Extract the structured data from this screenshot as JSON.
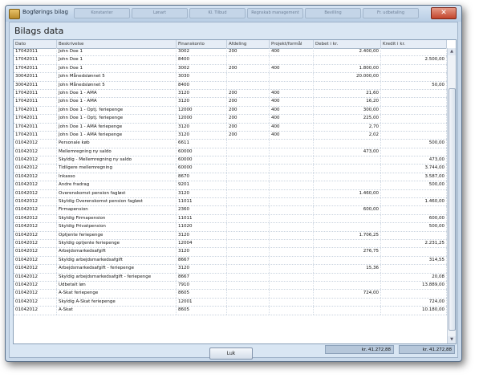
{
  "window": {
    "title": "Bogførings bilag",
    "background_tabs": [
      "Konstanter",
      "Lønart",
      "Kl. Tilbud",
      "Regnskab management",
      "Bevilling",
      "Fr. udbetaling"
    ],
    "close_glyph": "✕"
  },
  "heading": "Bilags data",
  "table": {
    "columns": [
      "Dato",
      "Beskrivelse",
      "Finanskonto",
      "Afdeling",
      "Projekt/formål",
      "Debet i kr.",
      "Kredit i kr."
    ],
    "rows": [
      [
        "17042011",
        "John Doe 1",
        "3002",
        "200",
        "400",
        "2.400,00",
        ""
      ],
      [
        "17042011",
        "John Doe 1",
        "8400",
        "",
        "",
        "",
        "2.500,00"
      ],
      [
        "17042011",
        "John Doe 1",
        "3002",
        "200",
        "400",
        "1.800,00",
        ""
      ],
      [
        "30042011",
        "John  Månedslønnet  5",
        "3030",
        "",
        "",
        "20.000,00",
        ""
      ],
      [
        "30042011",
        "John  Månedslønnet  5",
        "8400",
        "",
        "",
        "",
        "50,00"
      ],
      [
        "17042011",
        "John Doe 1 - AMA",
        "3120",
        "200",
        "400",
        "21,60",
        ""
      ],
      [
        "17042011",
        "John Doe 1 - AMA",
        "3120",
        "200",
        "400",
        "16,20",
        ""
      ],
      [
        "17042011",
        "John Doe 1 - Optj. feriepenge",
        "12000",
        "200",
        "400",
        "300,00",
        ""
      ],
      [
        "17042011",
        "John Doe 1 - Optj. feriepenge",
        "12000",
        "200",
        "400",
        "225,00",
        ""
      ],
      [
        "17042011",
        "John Doe 1 - AMA feriepenge",
        "3120",
        "200",
        "400",
        "2,70",
        ""
      ],
      [
        "17042011",
        "John Doe 1 - AMA feriepenge",
        "3120",
        "200",
        "400",
        "2,02",
        ""
      ],
      [
        "01042012",
        "Personale køb",
        "6611",
        "",
        "",
        "",
        "500,00"
      ],
      [
        "01042012",
        "Mellemregning ny saldo",
        "60000",
        "",
        "",
        "473,00",
        ""
      ],
      [
        "01042012",
        "Skyldig  - Mellemregning ny saldo",
        "60000",
        "",
        "",
        "",
        "473,00"
      ],
      [
        "01042012",
        "Tidligere mellemregning",
        "60000",
        "",
        "",
        "",
        "3.744,00"
      ],
      [
        "01042012",
        "Inkasso",
        "8670",
        "",
        "",
        "",
        "3.587,00"
      ],
      [
        "01042012",
        "Andre fradrag",
        "9201",
        "",
        "",
        "",
        "500,00"
      ],
      [
        "01042012",
        "Overenskomst pension fagløst",
        "3120",
        "",
        "",
        "1.460,00",
        ""
      ],
      [
        "01042012",
        "Skyldig Overenskomst pension fagløst",
        "11011",
        "",
        "",
        "",
        "1.460,00"
      ],
      [
        "01042012",
        "Firmapension",
        "2360",
        "",
        "",
        "600,00",
        ""
      ],
      [
        "01042012",
        "Skyldig Firmapension",
        "11011",
        "",
        "",
        "",
        "600,00"
      ],
      [
        "01042012",
        "Skyldig Privatpension",
        "11020",
        "",
        "",
        "",
        "500,00"
      ],
      [
        "01042012",
        "Optjente feriepenge",
        "3120",
        "",
        "",
        "1.706,25",
        ""
      ],
      [
        "01042012",
        "Skyldig optjente feriepenge",
        "12004",
        "",
        "",
        "",
        "2.231,25"
      ],
      [
        "01042012",
        "Arbejdsmarkedsafgift",
        "3120",
        "",
        "",
        "276,75",
        ""
      ],
      [
        "01042012",
        "Skyldig arbejdsmarkedsafgift",
        "8667",
        "",
        "",
        "",
        "314,55"
      ],
      [
        "01042012",
        "Arbejdsmarkedsafgift - feriepenge",
        "3120",
        "",
        "",
        "15,36",
        ""
      ],
      [
        "01042012",
        "Skyldig arbejdsmarkedsafgift - feriepenge",
        "8667",
        "",
        "",
        "",
        "20,08"
      ],
      [
        "01042012",
        "Udbetalt løn",
        "7910",
        "",
        "",
        "",
        "13.889,00"
      ],
      [
        "01042012",
        "A-Skat feriepenge",
        "8605",
        "",
        "",
        "724,00",
        ""
      ],
      [
        "01042012",
        "Skyldig A-Skat feriepenge",
        "12001",
        "",
        "",
        "",
        "724,00"
      ],
      [
        "01042012",
        "A-Skat",
        "8605",
        "",
        "",
        "",
        "10.180,00"
      ]
    ]
  },
  "totals": {
    "debet": "kr. 41.272,88",
    "kredit": "kr. 41.272,88"
  },
  "buttons": {
    "close_label": "Luk"
  }
}
